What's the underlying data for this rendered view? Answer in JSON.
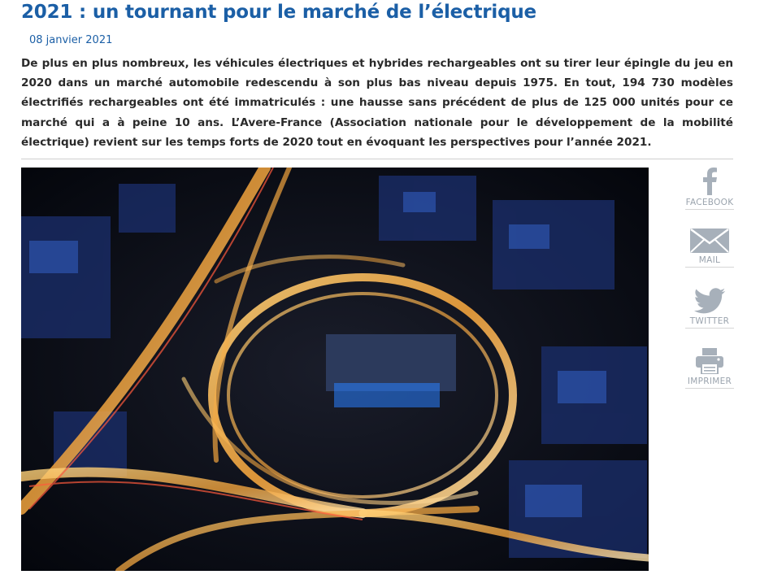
{
  "article": {
    "title": "2021 : un tournant pour le marché de l’électrique",
    "date": "08 janvier 2021",
    "intro": "De plus en plus nombreux, les véhicules électriques et hybrides rechargeables ont su tirer leur épingle du jeu en 2020 dans un marché automobile redescendu à son plus bas niveau depuis 1975. En tout, 194 730 modèles électrifiés rechargeables ont été immatriculés : une hausse sans précédent de plus de 125 000 unités pour ce marché qui a à peine 10 ans. L’Avere-France (Association nationale pour le développement de la mobilité électrique) revient sur les temps forts de 2020 tout en évoquant les perspectives pour l’année 2021."
  },
  "share": {
    "facebook_label": "FACEBOOK",
    "mail_label": "MAIL",
    "twitter_label": "TWITTER",
    "print_label": "IMPRIMER"
  },
  "colors": {
    "title": "#1b5fa6",
    "share_icon": "#a7b0ba",
    "photo_light": "#f5b64a"
  }
}
